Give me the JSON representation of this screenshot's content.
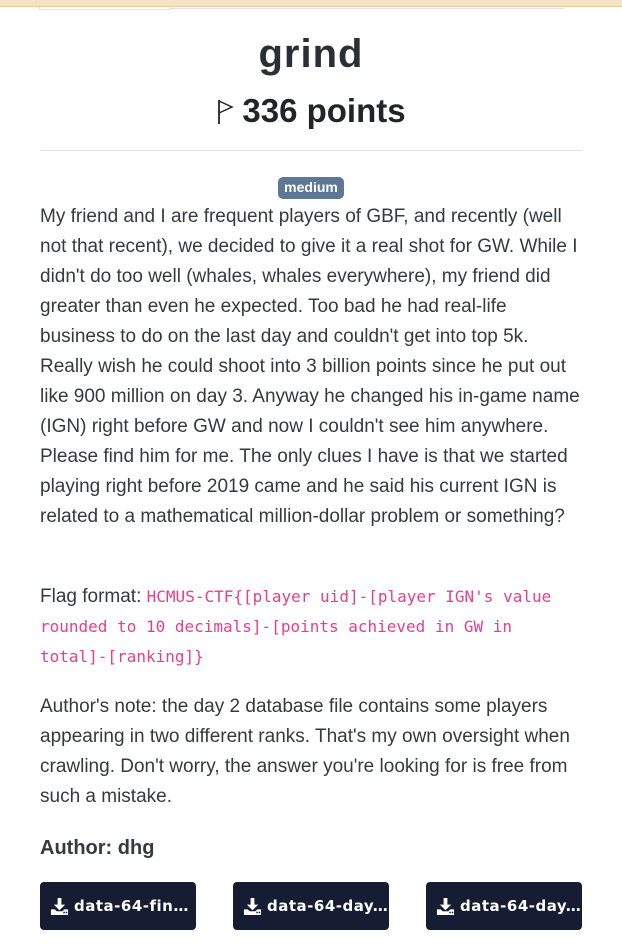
{
  "challenge": {
    "title": "grind",
    "points": "336 points",
    "difficulty": "medium",
    "description": "My friend and I are frequent players of GBF, and recently (well not that recent), we decided to give it a real shot for GW. While I didn't do too well (whales, whales everywhere), my friend did greater than even he expected. Too bad he had real-life business to do on the last day and couldn't get into top 5k. Really wish he could shoot into 3 billion points since he put out like 900 million on day 3. Anyway he changed his in-game name (IGN) right before GW and now I couldn't see him anywhere. Please find him for me. The only clues I have is that we started playing right before 2019 came and he said his current IGN is related to a mathematical million-dollar problem or something?",
    "flag_format_label": "Flag format: ",
    "flag_format_code": "HCMUS-CTF{[player uid]-[player IGN's value rounded to 10 decimals]-[points achieved in GW in total]-[ranking]}",
    "author_note": "Author's note: the day 2 database file contains some players appearing in two different ranks. That's my own oversight when crawling. Don't worry, the answer you're looking for is free from such a mistake.",
    "author": "Author: dhg"
  },
  "files": [
    {
      "label": "data-64-final..."
    },
    {
      "label": "data-64-day..."
    },
    {
      "label": "data-64-day..."
    }
  ],
  "icons": {
    "flag": "flag-icon",
    "download": "download-icon"
  },
  "colors": {
    "badge": "#5c7896",
    "code": "#e83e8c",
    "file_button": "#161d33"
  }
}
